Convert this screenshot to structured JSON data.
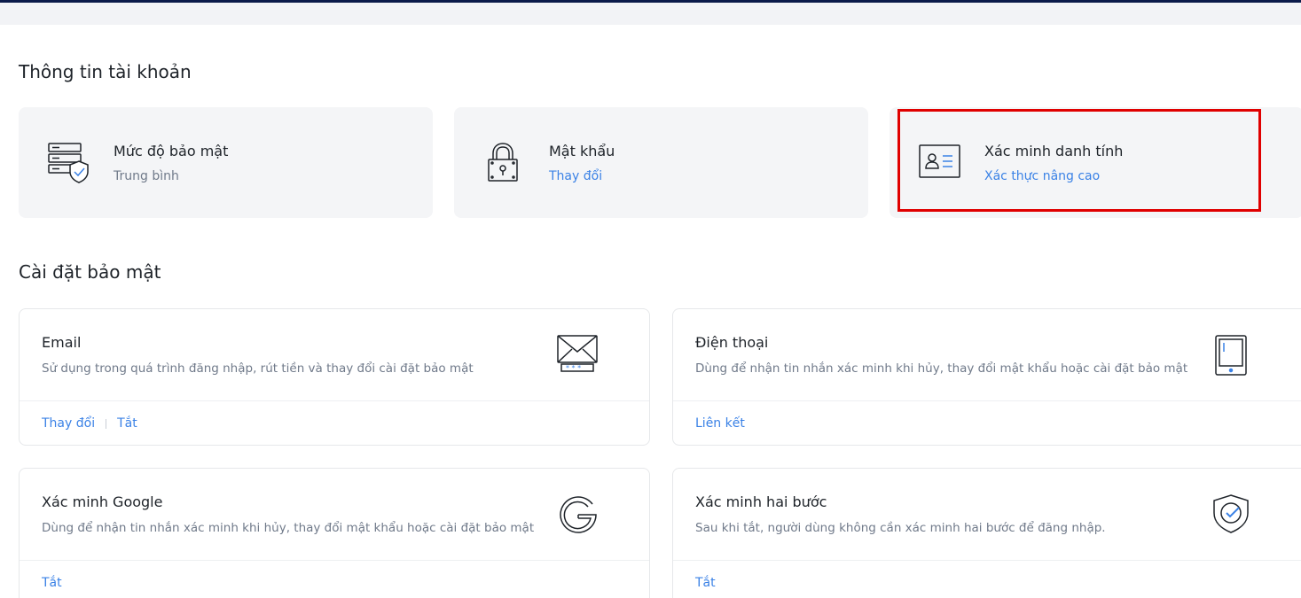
{
  "account_section": {
    "title": "Thông tin tài khoản",
    "cards": [
      {
        "title": "Mức độ bảo mật",
        "subtitle": "Trung bình",
        "icon": "security-level-icon"
      },
      {
        "title": "Mật khẩu",
        "subtitle": "Thay đổi",
        "icon": "lock-icon"
      },
      {
        "title": "Xác minh danh tính",
        "subtitle": "Xác thực nâng cao",
        "icon": "id-card-icon"
      }
    ]
  },
  "security_section": {
    "title": "Cài đặt bảo mật",
    "items": [
      {
        "name": "Email",
        "description": "Sử dụng trong quá trình đăng nhập, rút tiền và thay đổi cài đặt bảo mật",
        "actions": [
          "Thay đổi",
          "Tắt"
        ],
        "icon": "envelope-icon"
      },
      {
        "name": "Điện thoại",
        "description": "Dùng để nhận tin nhắn xác minh khi hủy, thay đổi mật khẩu hoặc cài đặt bảo mật",
        "actions": [
          "Liên kết"
        ],
        "icon": "phone-icon"
      },
      {
        "name": "Xác minh Google",
        "description": "Dùng để nhận tin nhắn xác minh khi hủy, thay đổi mật khẩu hoặc cài đặt bảo mật",
        "actions": [
          "Tắt"
        ],
        "icon": "google-icon"
      },
      {
        "name": "Xác minh hai bước",
        "description": "Sau khi tắt, người dùng không cần xác minh hai bước để đăng nhập.",
        "actions": [
          "Tắt"
        ],
        "icon": "shield-check-icon"
      }
    ]
  },
  "colors": {
    "link": "#3b82e6",
    "highlight": "#e00000",
    "text": "#1e2329",
    "muted": "#707a8a"
  }
}
